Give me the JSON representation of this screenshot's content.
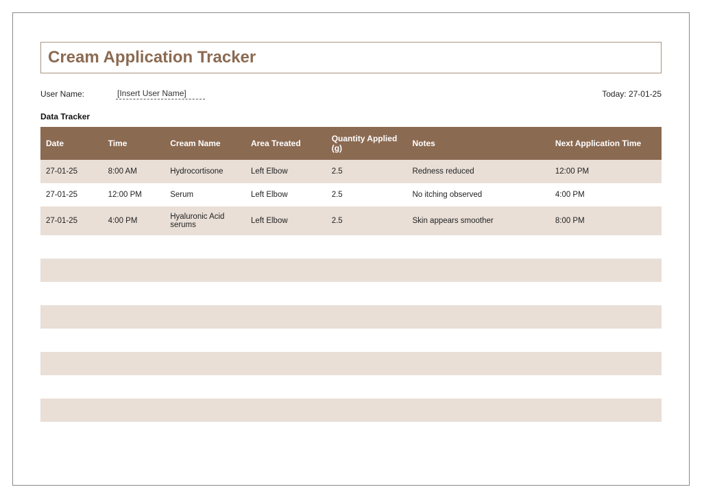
{
  "title": "Cream Application Tracker",
  "meta": {
    "username_label": "User Name:",
    "username_value": "[Insert User Name]",
    "today_label": "Today:",
    "today_value": "27-01-25"
  },
  "section_label": "Data Tracker",
  "columns": {
    "date": "Date",
    "time": "Time",
    "cream": "Cream Name",
    "area": "Area Treated",
    "qty": "Quantity Applied (g)",
    "notes": "Notes",
    "next": "Next Application Time"
  },
  "rows": [
    {
      "date": "27-01-25",
      "time": "8:00 AM",
      "cream": "Hydrocortisone",
      "area": "Left Elbow",
      "qty": "2.5",
      "notes": "Redness reduced",
      "next": "12:00 PM"
    },
    {
      "date": "27-01-25",
      "time": "12:00 PM",
      "cream": "Serum",
      "area": "Left Elbow",
      "qty": "2.5",
      "notes": "No itching observed",
      "next": "4:00 PM"
    },
    {
      "date": "27-01-25",
      "time": "4:00 PM",
      "cream": "Hyaluronic Acid serums",
      "area": "Left Elbow",
      "qty": "2.5",
      "notes": "Skin appears smoother",
      "next": "8:00 PM"
    },
    {
      "date": "",
      "time": "",
      "cream": "",
      "area": "",
      "qty": "",
      "notes": "",
      "next": ""
    },
    {
      "date": "",
      "time": "",
      "cream": "",
      "area": "",
      "qty": "",
      "notes": "",
      "next": ""
    },
    {
      "date": "",
      "time": "",
      "cream": "",
      "area": "",
      "qty": "",
      "notes": "",
      "next": ""
    },
    {
      "date": "",
      "time": "",
      "cream": "",
      "area": "",
      "qty": "",
      "notes": "",
      "next": ""
    },
    {
      "date": "",
      "time": "",
      "cream": "",
      "area": "",
      "qty": "",
      "notes": "",
      "next": ""
    },
    {
      "date": "",
      "time": "",
      "cream": "",
      "area": "",
      "qty": "",
      "notes": "",
      "next": ""
    },
    {
      "date": "",
      "time": "",
      "cream": "",
      "area": "",
      "qty": "",
      "notes": "",
      "next": ""
    },
    {
      "date": "",
      "time": "",
      "cream": "",
      "area": "",
      "qty": "",
      "notes": "",
      "next": ""
    },
    {
      "date": "",
      "time": "",
      "cream": "",
      "area": "",
      "qty": "",
      "notes": "",
      "next": ""
    }
  ]
}
